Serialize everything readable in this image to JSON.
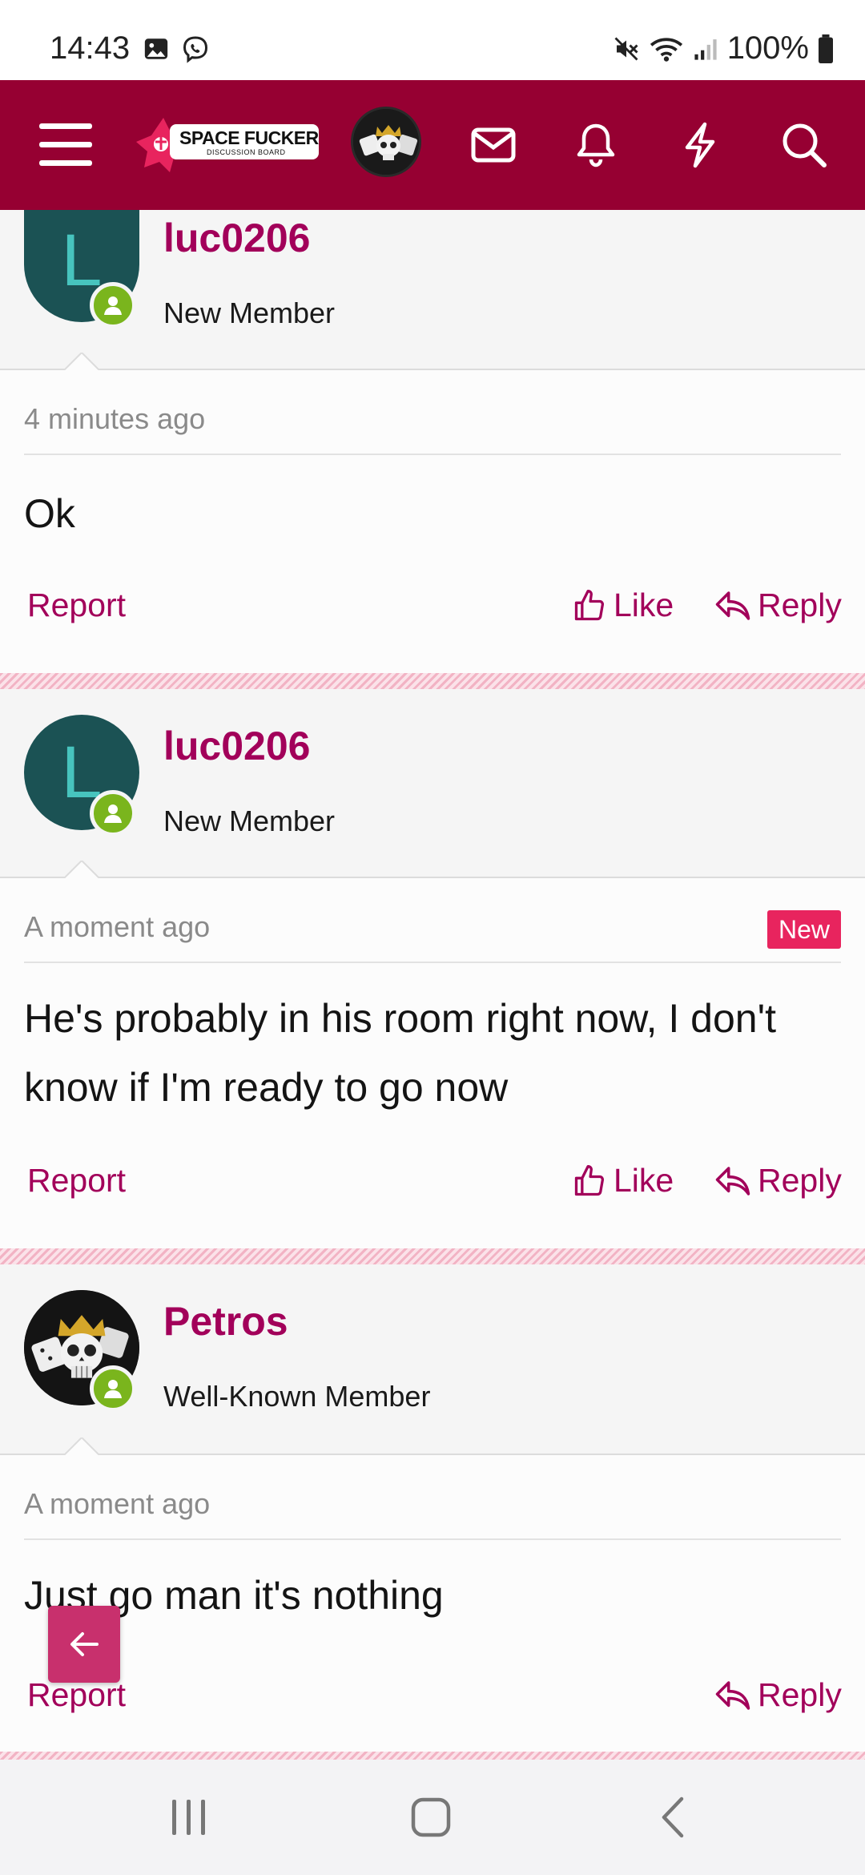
{
  "status_bar": {
    "time": "14:43",
    "battery": "100%"
  },
  "header": {
    "logo_title": "SPACE FUCKER",
    "logo_subtitle": "DISCUSSION BOARD",
    "icons": [
      "menu-icon",
      "mail-icon",
      "bell-icon",
      "lightning-icon",
      "search-icon"
    ]
  },
  "posts": [
    {
      "username": "luc0206",
      "user_title": "New Member",
      "avatar_letter": "L",
      "time": "4 minutes ago",
      "badge": "",
      "text": "Ok",
      "actions": {
        "report": "Report",
        "like": "Like",
        "reply": "Reply"
      }
    },
    {
      "username": "luc0206",
      "user_title": "New Member",
      "avatar_letter": "L",
      "time": "A moment ago",
      "badge": "New",
      "text": "He's probably in his room right now, I don't know if I'm ready to go now",
      "actions": {
        "report": "Report",
        "like": "Like",
        "reply": "Reply"
      }
    },
    {
      "username": "Petros",
      "user_title": "Well-Known Member",
      "avatar_letter": "",
      "time": "A moment ago",
      "badge": "",
      "text": "Just go man it's nothing",
      "actions": {
        "report": "Report",
        "reply": "Reply"
      }
    }
  ],
  "colors": {
    "header_bg": "#960032",
    "accent": "#a2005a",
    "new_badge": "#e8245e",
    "online": "#7ab51d",
    "avatar_bg": "#1b5254"
  }
}
